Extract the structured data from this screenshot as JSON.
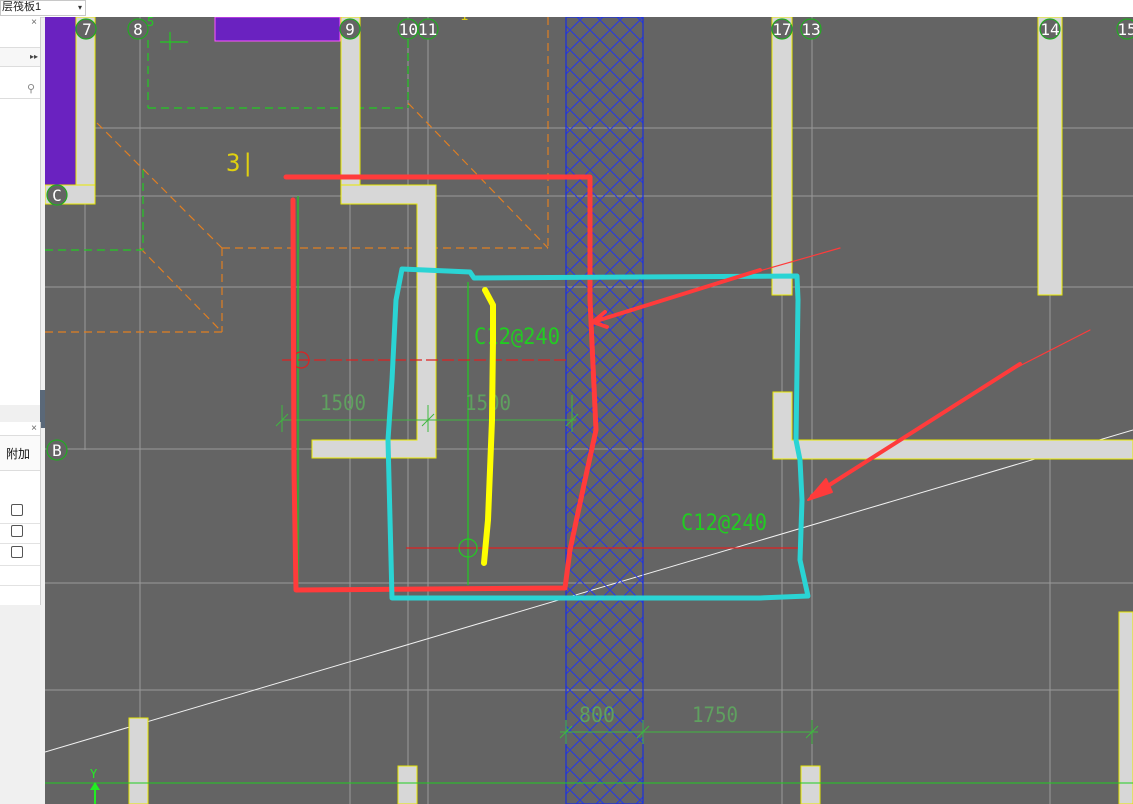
{
  "toolbar": {
    "layer_select": "层筏板1"
  },
  "panel_top": {
    "close_glyph": "×",
    "expand_glyph": "▸▸"
  },
  "panel_bottom": {
    "close_glyph": "×",
    "column_header": "附加",
    "rows": [
      {
        "checked": false
      },
      {
        "checked": false
      },
      {
        "checked": false
      }
    ]
  },
  "drawing": {
    "grid_labels": [
      "7",
      "8",
      "9",
      "1011",
      "17",
      "13",
      "14",
      "15",
      "C",
      "B"
    ],
    "beam_label_1": "C12@240",
    "beam_label_2": "C12@240",
    "dim_1500_a": "1500",
    "dim_1500_b": "1500",
    "dim_800": "800",
    "dim_1750": "1750",
    "room_label": "3|",
    "top_mark": "1",
    "axis_y": "Y",
    "small_mark": "5"
  },
  "colors": {
    "canvas_bg": "#646464",
    "wall_fill": "#d7d7d7",
    "wall_edge": "#e8e800",
    "purple_block": "#6a22c0",
    "rebar_green": "#22cc22",
    "dim_green": "#4aa84a",
    "orange_dash": "#e07f22",
    "hatch_blue": "#1a30e0",
    "annot_red": "#ff3b3b",
    "annot_cyan": "#2ad4d4",
    "annot_yellow": "#ffff00"
  }
}
